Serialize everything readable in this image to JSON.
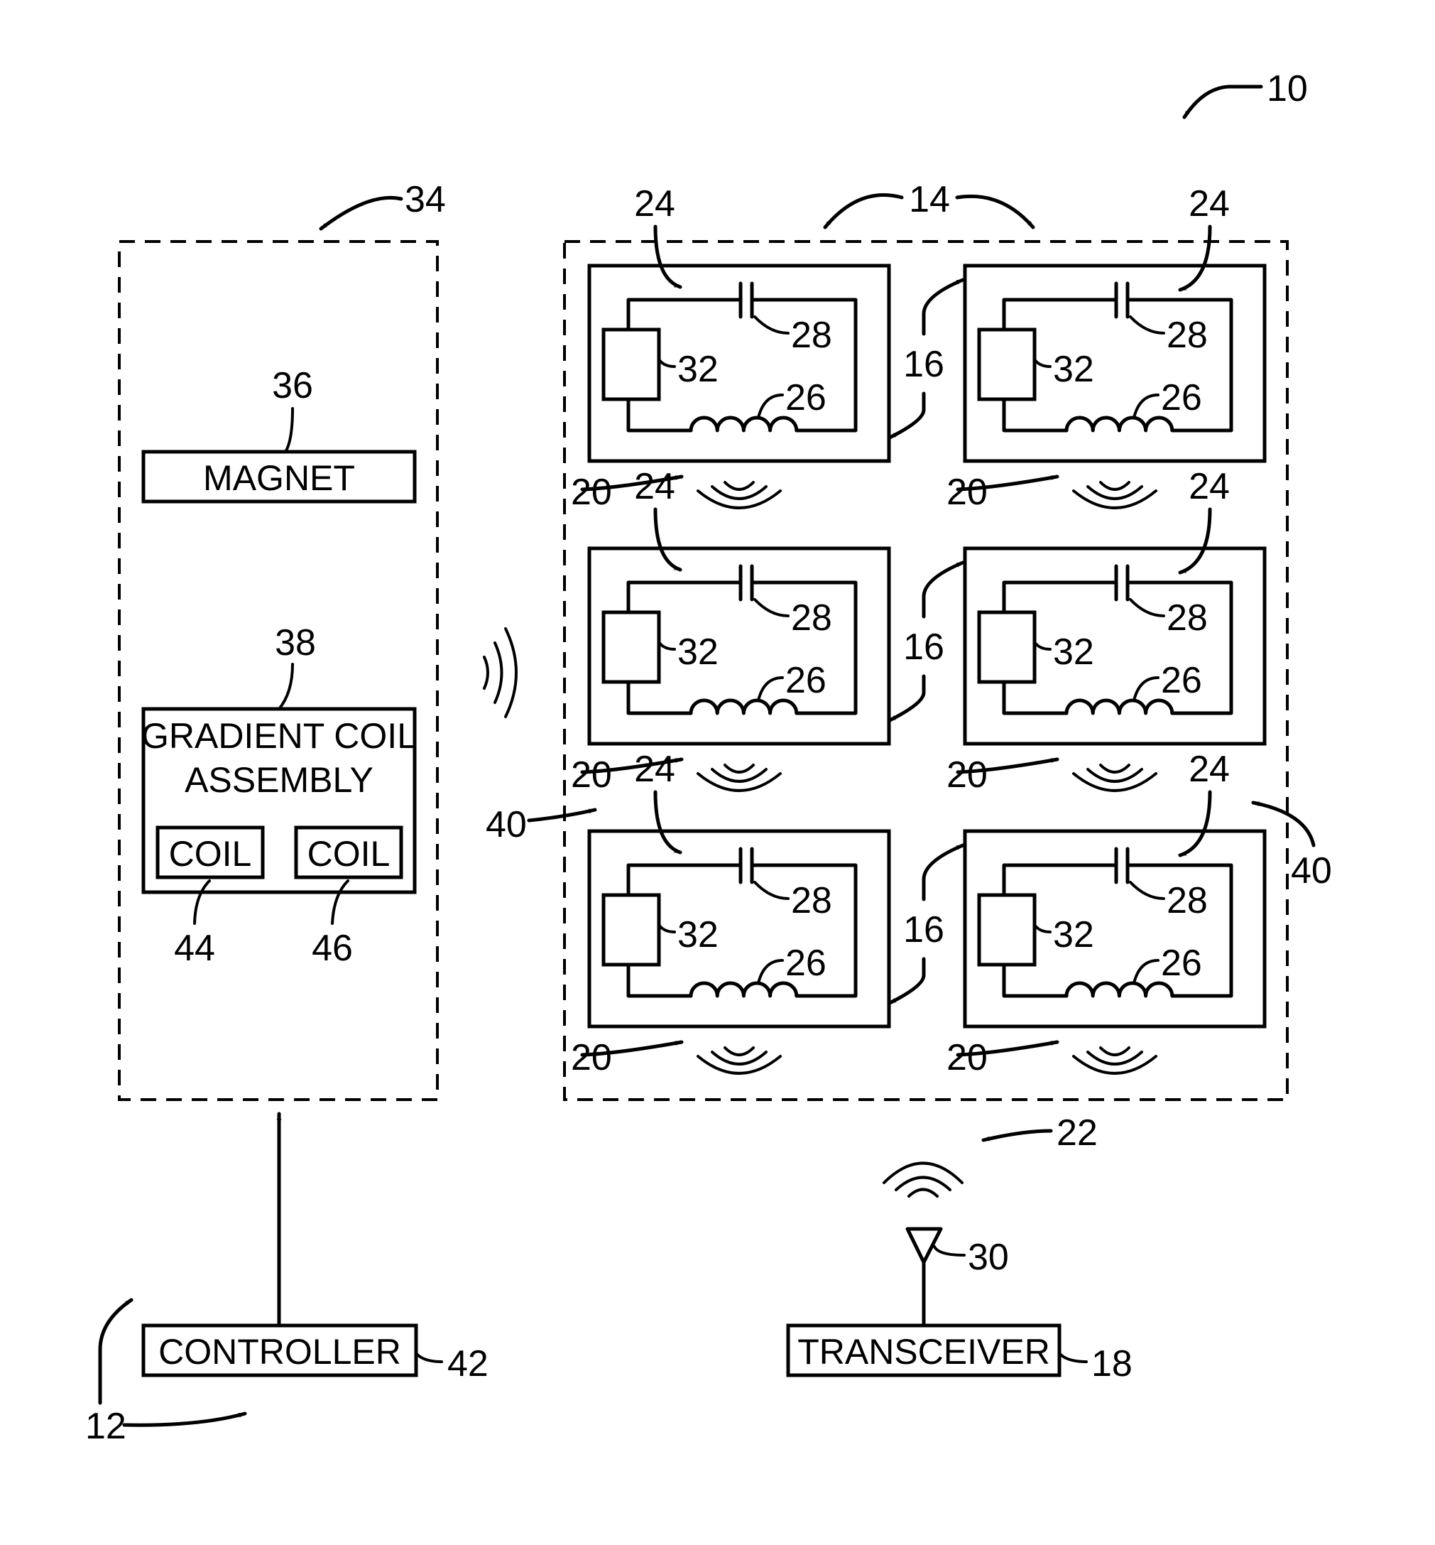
{
  "figure": {
    "ref_system": "10",
    "ref_subsystem": "12",
    "ref_scanner": "34",
    "ref_array": "14"
  },
  "scanner": {
    "magnet": {
      "ref": "36",
      "label": "MAGNET"
    },
    "gradient_coil_assembly": {
      "ref": "38",
      "label_line1": "GRADIENT  COIL",
      "label_line2": "ASSEMBLY",
      "coils": [
        {
          "ref": "44",
          "label": "COIL"
        },
        {
          "ref": "46",
          "label": "COIL"
        }
      ]
    }
  },
  "controller": {
    "ref": "42",
    "label": "CONTROLLER"
  },
  "transceiver": {
    "ref": "18",
    "label": "TRANSCEIVER",
    "antenna_ref": "30",
    "signal_ref": "22"
  },
  "array": {
    "link_ref": "16",
    "side_ref": "40",
    "cells": [
      {
        "frame_ref": "24",
        "capacitor_ref": "28",
        "inductor_ref": "26",
        "element_ref": "32",
        "signal_ref": "20"
      },
      {
        "frame_ref": "24",
        "capacitor_ref": "28",
        "inductor_ref": "26",
        "element_ref": "32",
        "signal_ref": "20"
      },
      {
        "frame_ref": "24",
        "capacitor_ref": "28",
        "inductor_ref": "26",
        "element_ref": "32",
        "signal_ref": "20"
      },
      {
        "frame_ref": "24",
        "capacitor_ref": "28",
        "inductor_ref": "26",
        "element_ref": "32",
        "signal_ref": "20"
      },
      {
        "frame_ref": "24",
        "capacitor_ref": "28",
        "inductor_ref": "26",
        "element_ref": "32",
        "signal_ref": "20"
      },
      {
        "frame_ref": "24",
        "capacitor_ref": "28",
        "inductor_ref": "26",
        "element_ref": "32",
        "signal_ref": "20"
      }
    ]
  }
}
